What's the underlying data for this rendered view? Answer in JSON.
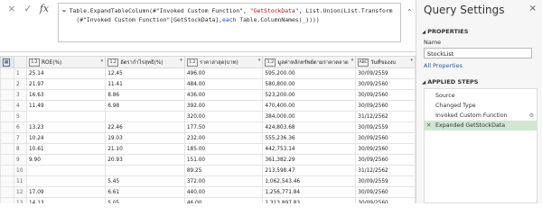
{
  "formula_bar": {
    "cancel_icon": "×",
    "confirm_icon": "✓",
    "fx_label": "fx",
    "line1_a": "= Table.ExpandTableColumn(#\"Invoked Custom Function\", ",
    "line1_str": "\"GetStockData\"",
    "line1_b": ", List.Union(List.Transform",
    "line2_a": "    (#\"Invoked Custom Function\"[GetStockData],",
    "line2_kw": "each",
    "line2_b": " Table.ColumnNames(_))))",
    "collapse_icon": "⌃"
  },
  "grid": {
    "columns": [
      {
        "type": "1.2",
        "label": "ROE(%)"
      },
      {
        "type": "1.2",
        "label": "อัตรากำไรสุทธิ(%)"
      },
      {
        "type": "1.2",
        "label": "ราคาล่าสุด(บาท)"
      },
      {
        "type": "1.2",
        "label": "มูลค่าหลักทรัพย์ตามราคาตลาด"
      },
      {
        "type": "ABC",
        "label": "วันที่ของงบ"
      }
    ],
    "rows": [
      [
        "1",
        "25.14",
        "12.45",
        "496.00",
        "595,200.00",
        "30/09/2559"
      ],
      [
        "2",
        "21.97",
        "11.41",
        "484.00",
        "580,800.00",
        "30/09/2560"
      ],
      [
        "3",
        "16.63",
        "8.86",
        "436.00",
        "523,200.00",
        "30/09/2560"
      ],
      [
        "4",
        "11.49",
        "6.98",
        "392.00",
        "470,400.00",
        "30/09/2560"
      ],
      [
        "5",
        "",
        "",
        "320.00",
        "384,000.00",
        "31/12/2562"
      ],
      [
        "6",
        "13.23",
        "22.46",
        "177.50",
        "424,803.68",
        "30/09/2559"
      ],
      [
        "7",
        "10.24",
        "19.03",
        "232.00",
        "555,236.36",
        "30/09/2560"
      ],
      [
        "8",
        "10.61",
        "21.10",
        "185.00",
        "442,753.14",
        "30/09/2560"
      ],
      [
        "9",
        "9.90",
        "20.93",
        "151.00",
        "361,382.29",
        "30/09/2560"
      ],
      [
        "10",
        "",
        "",
        "89.25",
        "213,598.47",
        "31/12/2562"
      ],
      [
        "11",
        "",
        "5.45",
        "372.00",
        "1,062,543.46",
        "30/09/2559"
      ],
      [
        "12",
        "17.09",
        "6.61",
        "440.00",
        "1,256,771.84",
        "30/09/2560"
      ],
      [
        "13",
        "14.13",
        "5.05",
        "46.00",
        "1,313,897.83",
        "30/09/2560"
      ]
    ]
  },
  "query_settings": {
    "title": "Query Settings",
    "close_icon": "×",
    "properties_heading": "PROPERTIES",
    "name_label": "Name",
    "name_value": "StockList",
    "all_properties_link": "All Properties",
    "applied_steps_heading": "APPLIED STEPS",
    "steps": [
      {
        "label": "Source"
      },
      {
        "label": "Changed Type"
      },
      {
        "label": "Invoked Custom Function"
      },
      {
        "label": "Expanded GetStockData"
      }
    ],
    "active_step_index": 3
  }
}
